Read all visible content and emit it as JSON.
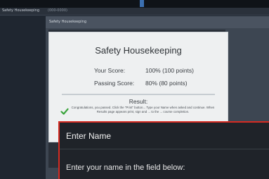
{
  "window": {
    "title": "Safety Housekeeping",
    "subtitle": "(000-0000)"
  },
  "app": {
    "header_label": "Safety Housekeeping"
  },
  "result_card": {
    "title": "Safety Housekeeping",
    "score_label": "Your Score:",
    "score_value": "100% (100 points)",
    "passing_label": "Passing Score:",
    "passing_value": "80% (80 points)",
    "result_title": "Result:",
    "result_text": "Congratulations, you passed. Click the \"Print\" button... Type your Name when asked and continue. When Results page appears print, sign and ... to the ... course completion."
  },
  "dialog": {
    "title": "Enter Name",
    "message": "Enter your name in the field below:"
  },
  "colors": {
    "dialog_border": "#d62b22",
    "check": "#3aa43c",
    "accent_marker": "#3b6fb0"
  }
}
